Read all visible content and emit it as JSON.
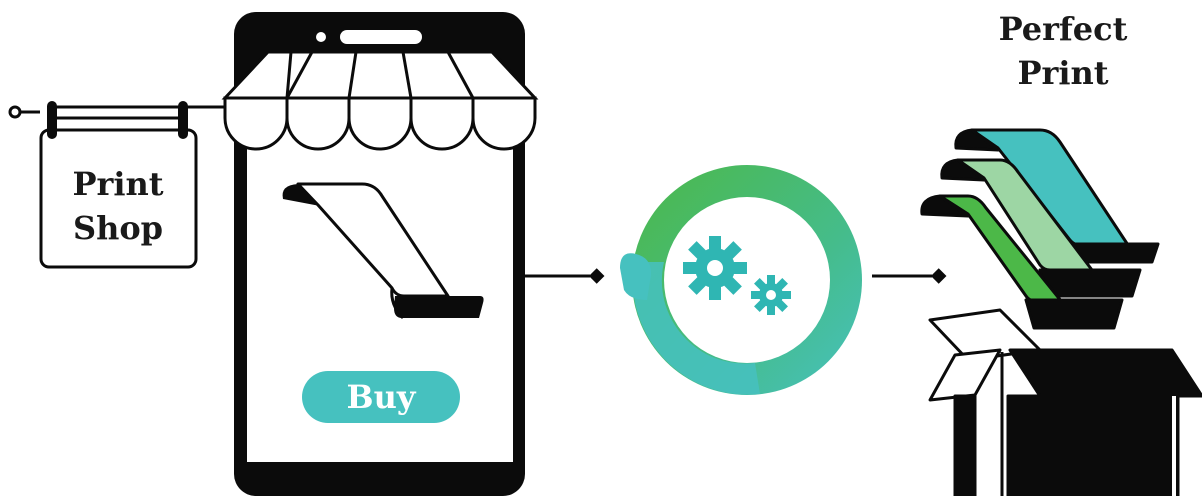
{
  "shop_sign": {
    "line1": "Print",
    "line2": "Shop"
  },
  "phone": {
    "buy_label": "Buy"
  },
  "result": {
    "line1": "Perfect",
    "line2": "Print"
  },
  "icons": {
    "sign": "hanging-sign-icon",
    "awning": "shop-awning-icon",
    "paper": "paper-sheet-icon",
    "process": "gears-icon",
    "output": "printed-sheets-icon",
    "package": "open-box-icon"
  },
  "colors": {
    "ink": "#0b0b0b",
    "teal": "#46c1bf",
    "green": "#4cb848",
    "light_green": "#9dd6a4",
    "paper": "#ffffff"
  }
}
